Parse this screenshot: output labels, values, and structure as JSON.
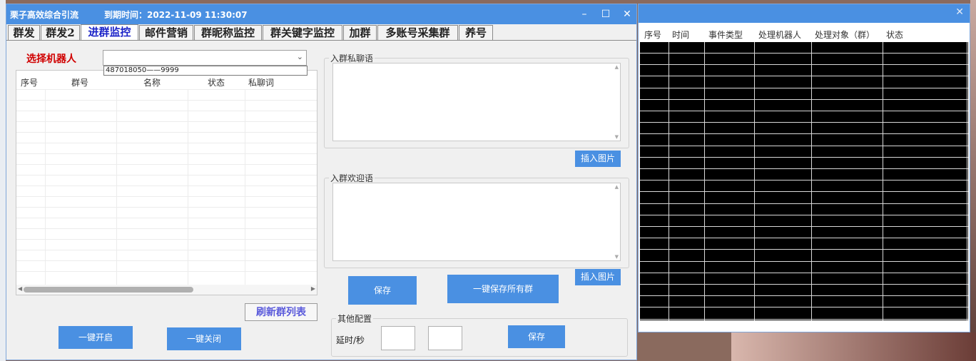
{
  "window": {
    "title": "栗子高效综合引流",
    "expire": "到期时间：2022-11-09 11:30:07",
    "minimize_icon": "–",
    "maximize_icon": "☐",
    "close_icon": "✕"
  },
  "tabs": [
    {
      "label": "群发"
    },
    {
      "label": "群发2"
    },
    {
      "label": "进群监控"
    },
    {
      "label": "邮件营销"
    },
    {
      "label": "群昵称监控"
    },
    {
      "label": "群关键字监控"
    },
    {
      "label": "加群"
    },
    {
      "label": "多账号采集群"
    },
    {
      "label": "养号"
    }
  ],
  "active_tab": "进群监控",
  "robot": {
    "label": "选择机器人",
    "selected": "",
    "dropdown_option": "487018050——9999"
  },
  "group_table": {
    "columns": [
      "序号",
      "群号",
      "名称",
      "状态",
      "私聊词"
    ]
  },
  "buttons": {
    "refresh": "刷新群列表",
    "enable_all": "一键开启",
    "disable_all": "一键关闭",
    "save": "保存",
    "save_all": "一键保存所有群",
    "insert_image_1": "插入图片",
    "insert_image_2": "插入图片",
    "config_save": "保存"
  },
  "private_msg": {
    "legend": "入群私聊语"
  },
  "welcome_msg": {
    "legend": "入群欢迎语"
  },
  "other_config": {
    "legend": "其他配置",
    "delay_label": "延时/秒",
    "delay_min": "",
    "delay_max": ""
  },
  "log_window": {
    "close_icon": "✕",
    "columns": [
      "序号",
      "时间",
      "事件类型",
      "处理机器人",
      "处理对象（群）",
      "状态"
    ]
  },
  "colors": {
    "accent": "#4a90e2",
    "active_tab": "#1c24c8",
    "robot_label": "#d00000",
    "refresh_text": "#5a5adb"
  }
}
